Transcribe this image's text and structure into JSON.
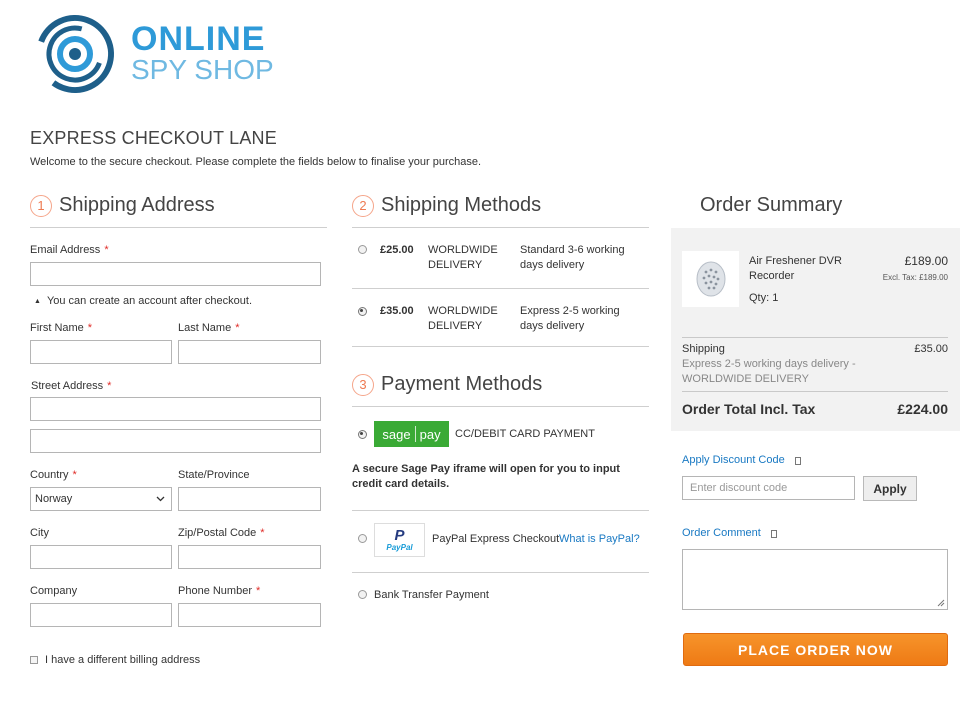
{
  "logo": {
    "line1": "ONLINE",
    "line2": "SPY SHOP"
  },
  "page": {
    "title": "EXPRESS CHECKOUT LANE",
    "subtitle": "Welcome to the secure checkout. Please complete the fields below to finalise your purchase."
  },
  "shipping_address": {
    "step": "1",
    "title": "Shipping Address",
    "email_label": "Email Address",
    "account_note": "You can create an account after checkout.",
    "first_name_label": "First Name",
    "last_name_label": "Last Name",
    "street_label": "Street Address",
    "country_label": "Country",
    "country_value": "Norway",
    "state_label": "State/Province",
    "city_label": "City",
    "zip_label": "Zip/Postal Code",
    "company_label": "Company",
    "phone_label": "Phone Number",
    "billing_checkbox_label": "I have a different billing address",
    "required_mark": "*"
  },
  "shipping_methods": {
    "step": "2",
    "title": "Shipping Methods",
    "options": [
      {
        "price": "£25.00",
        "carrier_line1": "WORLDWIDE",
        "carrier_line2": "DELIVERY",
        "desc_line1": "Standard 3-6 working",
        "desc_line2": "days delivery",
        "selected": false
      },
      {
        "price": "£35.00",
        "carrier_line1": "WORLDWIDE",
        "carrier_line2": "DELIVERY",
        "desc_line1": "Express 2-5 working",
        "desc_line2": "days delivery",
        "selected": true
      }
    ]
  },
  "payment_methods": {
    "step": "3",
    "title": "Payment Methods",
    "sagepay_logo_left": "sage",
    "sagepay_logo_right": "pay",
    "sagepay_label": "CC/DEBIT CARD PAYMENT",
    "sagepay_note_line1": "A secure Sage Pay iframe will open for you to input",
    "sagepay_note_line2": "credit card details.",
    "paypal_logo": "PayPal",
    "paypal_label": "PayPal Express Checkout",
    "paypal_link": "What is PayPal?",
    "bank_label": "Bank Transfer Payment"
  },
  "order_summary": {
    "title": "Order Summary",
    "item_name_line1": "Air Freshener DVR",
    "item_name_line2": "Recorder",
    "item_qty": "Qty: 1",
    "item_price": "£189.00",
    "item_excl_tax": "Excl. Tax: £189.00",
    "shipping_label": "Shipping",
    "shipping_amount": "£35.00",
    "shipping_desc_line1": "Express 2-5 working days delivery -",
    "shipping_desc_line2": "WORLDWIDE DELIVERY",
    "total_label": "Order Total Incl. Tax",
    "total_amount": "£224.00"
  },
  "discount": {
    "label": "Apply Discount Code",
    "placeholder": "Enter discount code",
    "button": "Apply"
  },
  "comment": {
    "label": "Order Comment"
  },
  "place_order": {
    "label": "PLACE ORDER NOW"
  },
  "colors": {
    "brand_blue": "#2e9ad8",
    "brand_dark": "#1e5f8a",
    "step_orange": "#ee7a52",
    "cta_orange": "#f7942a",
    "link_blue": "#1979c3",
    "sagepay_green": "#3aaa35"
  }
}
